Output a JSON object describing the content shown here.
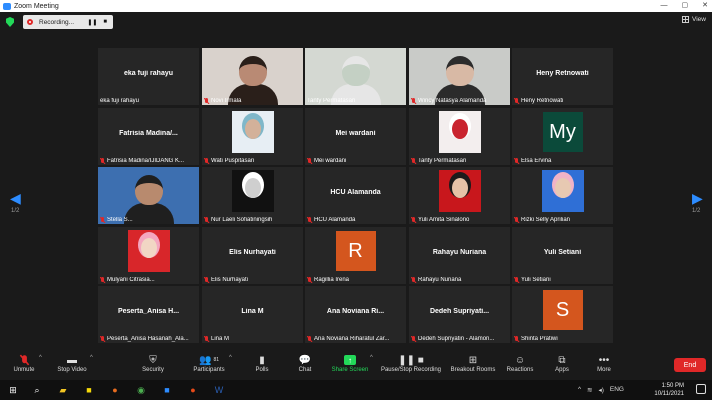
{
  "window": {
    "title": "Zoom Meeting",
    "min": "—",
    "max": "▢",
    "close": "✕"
  },
  "recording": {
    "label": "Recording...",
    "pause": "❚❚",
    "stop": "■"
  },
  "view": {
    "label": "View"
  },
  "nav": {
    "left_page": "1/2",
    "right_page": "1/2"
  },
  "tiles": [
    {
      "center": "eka fuji rahayu",
      "name": "eka fuji rahayu",
      "muted": false,
      "type": "name"
    },
    {
      "center": "",
      "name": "Novi Irmala",
      "muted": true,
      "type": "video",
      "bg": "#d9d2cc",
      "skin": "#b98a74",
      "hair": "#2a1f1a"
    },
    {
      "center": "",
      "name": "Tanty Permatasari",
      "muted": false,
      "type": "video",
      "bg": "#d4d8d2",
      "skin": "#c4d0c4",
      "hair": "#e6e6e6",
      "active": true
    },
    {
      "center": "",
      "name": "Wincy Natasya Alamanda",
      "muted": true,
      "type": "video",
      "bg": "#c9cbc8",
      "skin": "#d8b9a5",
      "hair": "#2b2b2b"
    },
    {
      "center": "Heny Retnowati",
      "name": "Heny Retnowati",
      "muted": true,
      "type": "name"
    },
    {
      "center": "Fatrisia  Madina/...",
      "name": "Fatrisia Madina/IJIDANG K...",
      "muted": true,
      "type": "name"
    },
    {
      "center": "",
      "name": "Wati Puspitasari",
      "muted": true,
      "type": "photo",
      "bg": "#e7eef4",
      "skin": "#d3b19a",
      "hair": "#7fb7c9"
    },
    {
      "center": "Mei wardani",
      "name": "Mei wardani",
      "muted": true,
      "type": "name"
    },
    {
      "center": "",
      "name": "Tanty Permatasari",
      "muted": true,
      "type": "photo",
      "bg": "#f3eeee",
      "skin": "#c9242f",
      "hair": "#ffffff"
    },
    {
      "center": "",
      "name": "Elsa Ervina",
      "muted": true,
      "type": "letter",
      "letter": "My",
      "color": "#0b4a3a"
    },
    {
      "center": "",
      "name": "Stella S...",
      "muted": true,
      "type": "video",
      "bg": "#3d6fb0",
      "skin": "#b88a6e",
      "hair": "#1f1f1f"
    },
    {
      "center": "",
      "name": "Nur Laeli Sofiatiningsih",
      "muted": true,
      "type": "photo",
      "bg": "#111111",
      "skin": "#cfcfcf",
      "hair": "#ffffff"
    },
    {
      "center": "HCU Alamanda",
      "name": "HCU Alamanda",
      "muted": true,
      "type": "name"
    },
    {
      "center": "",
      "name": "Yuli Amita Sinalono",
      "muted": true,
      "type": "photo",
      "bg": "#c8171c",
      "skin": "#e5c2a7",
      "hair": "#1b1b1b"
    },
    {
      "center": "",
      "name": "Rizki Selly Aprilian",
      "muted": true,
      "type": "photo",
      "bg": "#2f6fd6",
      "skin": "#e7c9b2",
      "hair": "#f0b3c7"
    },
    {
      "center": "",
      "name": "Mulyani Citrasia...",
      "muted": true,
      "type": "photo",
      "bg": "#d8262a",
      "skin": "#f1d6c4",
      "hair": "#f4a6bf"
    },
    {
      "center": "Elis Nurhayati",
      "name": "Elis Nurhayati",
      "muted": true,
      "type": "name"
    },
    {
      "center": "",
      "name": "Ragillia Irena",
      "muted": true,
      "type": "letter",
      "letter": "R",
      "color": "#d4561e"
    },
    {
      "center": "Rahayu Nuriana",
      "name": "Rahayu Nuriana",
      "muted": true,
      "type": "name"
    },
    {
      "center": "Yuli Setiani",
      "name": "Yuli Setiani",
      "muted": true,
      "type": "name"
    },
    {
      "center": "Peserta_Anisa  H...",
      "name": "Peserta_Anisa Hasanah_Ala...",
      "muted": true,
      "type": "name"
    },
    {
      "center": "Lina M",
      "name": "Lina M",
      "muted": true,
      "type": "name"
    },
    {
      "center": "Ana  Noviana  Ri...",
      "name": "Ana Noviana Riharatul Zar...",
      "muted": true,
      "type": "name"
    },
    {
      "center": "Dedeh  Supriyati...",
      "name": "Dedeh Supriyatin - Alamon...",
      "muted": true,
      "type": "name"
    },
    {
      "center": "",
      "name": "Shinta Pratiwi",
      "muted": true,
      "type": "letter",
      "letter": "S",
      "color": "#d4561e"
    }
  ],
  "toolbar": {
    "unmute": "Unmute",
    "stop_video": "Stop Video",
    "security": "Security",
    "participants": "Participants",
    "participants_count": "81",
    "polls": "Polls",
    "chat": "Chat",
    "share_screen": "Share Screen",
    "pause_stop_recording": "Pause/Stop Recording",
    "breakout_rooms": "Breakout Rooms",
    "reactions": "Reactions",
    "apps": "Apps",
    "more": "More",
    "end": "End"
  },
  "taskbar": {
    "lang": "ENG",
    "time": "1:50 PM",
    "date": "10/11/2021"
  }
}
